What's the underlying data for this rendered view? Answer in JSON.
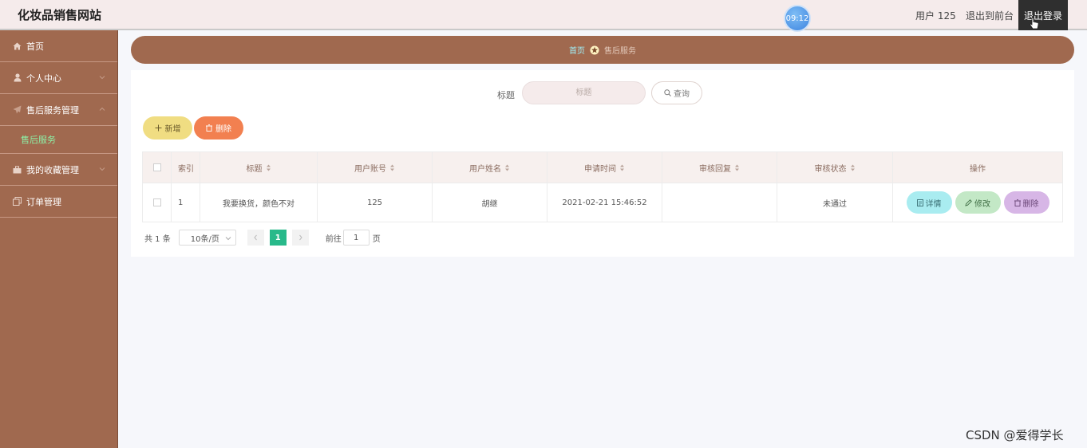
{
  "header": {
    "brand": "化妆品销售网站",
    "clock": "09:12",
    "user": "用户 125",
    "front_link": "退出到前台",
    "logout": "退出登录"
  },
  "sidebar": {
    "items": [
      {
        "label": "首页",
        "icon": "home-icon",
        "expandable": false
      },
      {
        "label": "个人中心",
        "icon": "user-icon",
        "expandable": true
      },
      {
        "label": "售后服务管理",
        "icon": "send-icon",
        "expandable": true,
        "expanded": true,
        "children": [
          {
            "label": "售后服务",
            "active": true
          }
        ]
      },
      {
        "label": "我的收藏管理",
        "icon": "briefcase-icon",
        "expandable": true
      },
      {
        "label": "订单管理",
        "icon": "copy-icon",
        "expandable": false
      }
    ]
  },
  "breadcrumb": {
    "home": "首页",
    "current": "售后服务"
  },
  "search": {
    "label": "标题",
    "placeholder": "标题",
    "button": "查询"
  },
  "actions": {
    "add": "新增",
    "delete": "删除"
  },
  "table": {
    "columns": [
      "索引",
      "标题",
      "用户账号",
      "用户姓名",
      "申请时间",
      "审核回复",
      "审核状态",
      "操作"
    ],
    "rows": [
      {
        "index": "1",
        "title": "我要换货，颜色不对",
        "account": "125",
        "name": "胡继",
        "time": "2021-02-21 15:46:52",
        "reply": "",
        "status": "未通过"
      }
    ],
    "op_buttons": {
      "detail": "详情",
      "edit": "修改",
      "delete": "删除"
    }
  },
  "pagination": {
    "total": "共 1 条",
    "page_size": "10条/页",
    "current_page": "1",
    "goto_label": "前往",
    "goto_value": "1",
    "page_suffix": "页"
  },
  "watermark": "CSDN @爱得学长",
  "colors": {
    "sidebar": "#a0694f",
    "header": "#f5ebeb",
    "active_submenu": "#8df0a6",
    "pager_active": "#28b98a"
  }
}
